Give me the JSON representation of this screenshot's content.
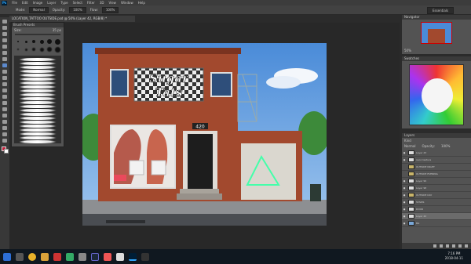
{
  "app": {
    "logo": "Ps",
    "menu": [
      "File",
      "Edit",
      "Image",
      "Layer",
      "Type",
      "Select",
      "Filter",
      "3D",
      "View",
      "Window",
      "Help"
    ]
  },
  "options": {
    "mode_label": "Mode:",
    "mode": "Normal",
    "opacity_label": "Opacity:",
    "opacity": "100%",
    "flow_label": "Flow:",
    "flow": "100%",
    "workspace": "Essentials"
  },
  "document": {
    "tab": "LOCATION_TATTOO OUTSIDE.psd @ 50% (Layer 42, RGB/8) *"
  },
  "brush_presets": {
    "title": "Brush Presets",
    "size_label": "Size:",
    "size": "35 px"
  },
  "artwork": {
    "sign_line1": "Sugar",
    "sign_line2": "Tats",
    "door_number": "420"
  },
  "navigator": {
    "title": "Navigator",
    "zoom": "50%"
  },
  "swatches": {
    "title": "Swatches"
  },
  "layers": {
    "title": "Layers",
    "kind": "Kind",
    "blend": "Normal",
    "opacity_label": "Opacity:",
    "opacity": "100%",
    "items": [
      "Layer 43",
      "neon texture",
      "OUTSIDE NIGHT",
      "OUTSIDE EVENING",
      "Layer 99",
      "Layer 98",
      "OUTSIDE DAY",
      "STAIRS",
      "DOOR",
      "Layer 42",
      "BG"
    ],
    "selected": "Layer 42"
  },
  "taskbar": {
    "time": "7:16 PM",
    "date": "2018-04-11"
  }
}
